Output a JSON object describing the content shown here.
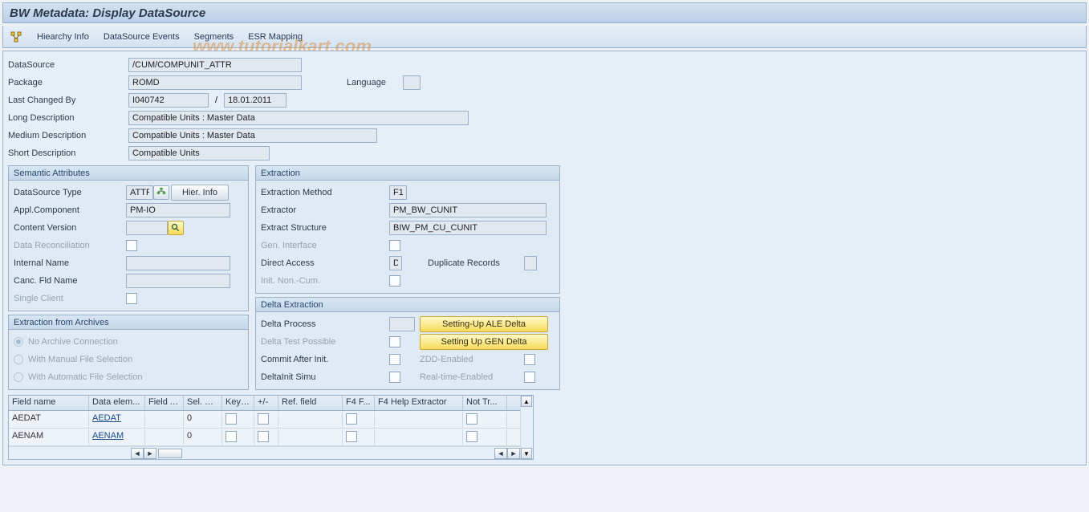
{
  "title": "BW Metadata: Display DataSource",
  "toolbar": {
    "hierarchy_info": "Hiearchy Info",
    "datasource_events": "DataSource Events",
    "segments": "Segments",
    "esr_mapping": "ESR Mapping"
  },
  "hdr": {
    "datasource_lbl": "DataSource",
    "datasource_val": "/CUM/COMPUNIT_ATTR",
    "package_lbl": "Package",
    "package_val": "ROMD",
    "language_lbl": "Language",
    "language_val": "",
    "lastchg_lbl": "Last Changed By",
    "lastchg_user": "I040742",
    "lastchg_date": "18.01.2011",
    "longdesc_lbl": "Long Description",
    "longdesc_val": "Compatible Units : Master Data",
    "meddesc_lbl": "Medium Description",
    "meddesc_val": "Compatible Units : Master Data",
    "shortdesc_lbl": "Short Description",
    "shortdesc_val": "Compatible Units"
  },
  "sem": {
    "title": "Semantic Attributes",
    "ds_type_lbl": "DataSource Type",
    "ds_type_val": "ATTR",
    "hier_info_btn": "Hier. Info",
    "appl_comp_lbl": "Appl.Component",
    "appl_comp_val": "PM-IO",
    "content_ver_lbl": "Content Version",
    "content_ver_val": "",
    "data_recon_lbl": "Data Reconciliation",
    "internal_name_lbl": "Internal Name",
    "internal_name_val": "",
    "canc_fld_lbl": "Canc. Fld Name",
    "canc_fld_val": "",
    "single_client_lbl": "Single Client"
  },
  "arch": {
    "title": "Extraction from Archives",
    "opt_none": "No Archive Connection",
    "opt_manual": "With Manual File Selection",
    "opt_auto": "With Automatic File Selection"
  },
  "extr": {
    "title": "Extraction",
    "method_lbl": "Extraction Method",
    "method_val": "F1",
    "extractor_lbl": "Extractor",
    "extractor_val": "PM_BW_CUNIT",
    "struct_lbl": "Extract Structure",
    "struct_val": "BIW_PM_CU_CUNIT",
    "gen_iface_lbl": "Gen. Interface",
    "direct_lbl": "Direct Access",
    "direct_val": "D",
    "dup_lbl": "Duplicate Records",
    "init_non_lbl": "Init. Non.-Cum."
  },
  "delta": {
    "title": "Delta Extraction",
    "process_lbl": "Delta Process",
    "process_val": "",
    "test_lbl": "Delta Test Possible",
    "commit_lbl": "Commit After Init.",
    "simu_lbl": "DeltaInit Simu",
    "btn_ale": "Setting-Up ALE Delta",
    "btn_gen": "Setting Up GEN Delta",
    "zdd_lbl": "ZDD-Enabled",
    "rt_lbl": "Real-time-Enabled"
  },
  "table": {
    "cols": [
      "Field name",
      "Data elem...",
      "Field A...",
      "Sel. O...",
      "Key ...",
      "+/-",
      "Ref. field",
      "F4 F...",
      "F4 Help Extractor",
      "Not Tr..."
    ],
    "widths": [
      100,
      70,
      48,
      48,
      40,
      30,
      80,
      40,
      110,
      55
    ],
    "rows": [
      {
        "field": "AEDAT",
        "elem": "AEDAT",
        "attr": "",
        "sel": "0",
        "key": false,
        "pm": false,
        "ref": "",
        "f4f": false,
        "f4h": "",
        "not": false
      },
      {
        "field": "AENAM",
        "elem": "AENAM",
        "attr": "",
        "sel": "0",
        "key": false,
        "pm": false,
        "ref": "",
        "f4f": false,
        "f4h": "",
        "not": false
      }
    ]
  },
  "watermark": "www.tutorialkart.com"
}
